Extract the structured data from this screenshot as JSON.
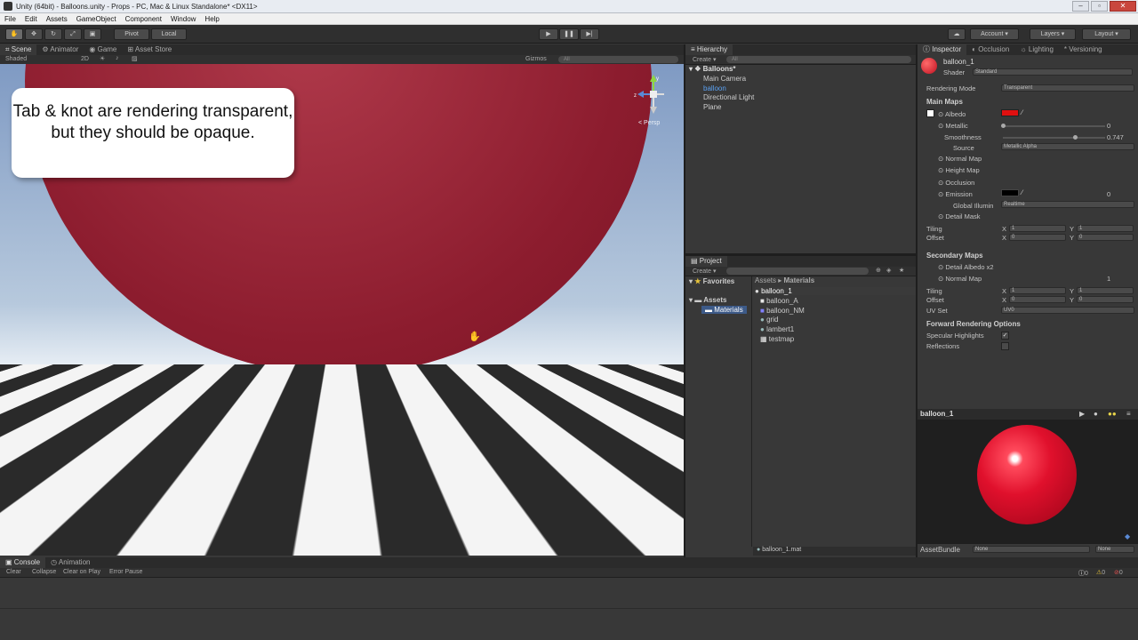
{
  "window": {
    "title": "Unity (64bit) - Balloons.unity - Props - PC, Mac & Linux Standalone* <DX11>"
  },
  "menu": [
    "File",
    "Edit",
    "Assets",
    "GameObject",
    "Component",
    "Window",
    "Help"
  ],
  "toolbar": {
    "pivot": "Pivot",
    "local": "Local",
    "account": "Account",
    "layers": "Layers",
    "layout": "Layout"
  },
  "scene": {
    "tabs": [
      "Scene",
      "Animator",
      "Game",
      "Asset Store"
    ],
    "shaded": "Shaded",
    "mode2d": "2D",
    "gizmos": "Gizmos",
    "search": "All",
    "persp": "< Persp",
    "callout": "Tab & knot are rendering transparent, but they should be opaque."
  },
  "hierarchy": {
    "tab": "Hierarchy",
    "create": "Create",
    "search": "All",
    "root": "Balloons*",
    "items": [
      "Main Camera",
      "balloon",
      "Directional Light",
      "Plane"
    ]
  },
  "project": {
    "tab": "Project",
    "create": "Create",
    "favorites": "Favorites",
    "assets": "Assets",
    "materials_folder": "Materials",
    "breadcrumb": [
      "Assets",
      "Materials"
    ],
    "items": [
      "balloon_1",
      "balloon_A",
      "balloon_NM",
      "grid",
      "lambert1",
      "testmap"
    ],
    "footer": "balloon_1.mat"
  },
  "inspector": {
    "tabs": [
      "Inspector",
      "Occlusion",
      "Lighting",
      "Versioning"
    ],
    "name": "balloon_1",
    "shader_label": "Shader",
    "shader": "Standard",
    "rendering_mode_label": "Rendering Mode",
    "rendering_mode": "Transparent",
    "main_maps": "Main Maps",
    "albedo": "Albedo",
    "metallic": "Metallic",
    "metallic_value": "0",
    "smoothness": "Smoothness",
    "smoothness_value": "0.747",
    "source": "Source",
    "source_value": "Metallic Alpha",
    "normal_map": "Normal Map",
    "height_map": "Height Map",
    "occlusion": "Occlusion",
    "emission": "Emission",
    "emission_value": "0",
    "gi": "Global Illumin",
    "gi_value": "Realtime",
    "detail_mask": "Detail Mask",
    "tiling": "Tiling",
    "offset": "Offset",
    "x": "X",
    "y": "Y",
    "one": "1",
    "zero": "0",
    "secondary_maps": "Secondary Maps",
    "detail_albedo": "Detail Albedo x2",
    "normal_map2": "Normal Map",
    "normal_map2_value": "1",
    "uv_set": "UV Set",
    "uv_set_value": "UV0",
    "forward": "Forward Rendering Options",
    "specular": "Specular Highlights",
    "reflections": "Reflections",
    "albedo_color": "#e01010",
    "emission_color": "#000000"
  },
  "preview": {
    "title": "balloon_1",
    "assetbundle": "AssetBundle",
    "none1": "None",
    "none2": "None"
  },
  "console": {
    "tabs": [
      "Console",
      "Animation"
    ],
    "buttons": [
      "Clear",
      "Collapse",
      "Clear on Play",
      "Error Pause"
    ],
    "counts": [
      "0",
      "0",
      "0"
    ]
  }
}
